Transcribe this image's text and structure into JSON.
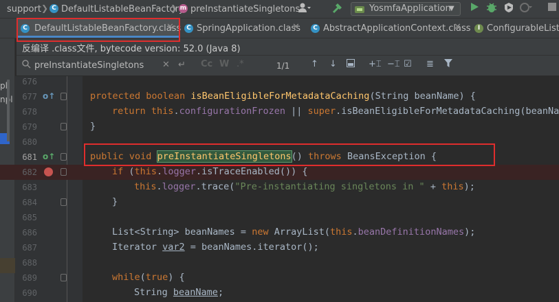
{
  "breadcrumb": {
    "items": [
      "support",
      "DefaultListableBeanFactory",
      "preInstantiateSingletons"
    ],
    "item_icons": [
      "",
      "class-icon",
      "method-icon"
    ]
  },
  "toolbar": {
    "run_config": "YosmfaApplication",
    "icons": [
      "user-icon",
      "build-hammer-icon",
      "run-icon",
      "debug-icon",
      "coverage-icon",
      "profile-icon",
      "stop-icon"
    ]
  },
  "tabs": [
    {
      "label": "DefaultListableBeanFactory.class",
      "active": true
    },
    {
      "label": "SpringApplication.class",
      "active": false
    },
    {
      "label": "AbstractApplicationContext.class",
      "active": false
    },
    {
      "label": "ConfigurableListab",
      "active": false
    }
  ],
  "banner": {
    "text": "反编译 .class文件, bytecode version: 52.0 (Java 8)"
  },
  "search": {
    "query": "preInstantiateSingletons",
    "match_count": "1/1",
    "case_label": "Cc",
    "word_label": "W",
    "regex_label": ".*"
  },
  "left_panel": {
    "labels": [
      "pl",
      "npl"
    ]
  },
  "code": {
    "lines": [
      {
        "num": "676",
        "text": ""
      },
      {
        "num": "677",
        "text": "protected boolean isBeanEligibleForMetadataCaching(String beanName) {"
      },
      {
        "num": "678",
        "text": "return this.configurationFrozen || super.isBeanEligibleForMetadataCaching(beanName"
      },
      {
        "num": "679",
        "text": "}"
      },
      {
        "num": "680",
        "text": ""
      },
      {
        "num": "681",
        "text": "public void preInstantiateSingletons() throws BeansException {"
      },
      {
        "num": "682",
        "text": "if (this.logger.isTraceEnabled()) {"
      },
      {
        "num": "683",
        "text": "this.logger.trace(\"Pre-instantiating singletons in \" + this);"
      },
      {
        "num": "684",
        "text": "}"
      },
      {
        "num": "685",
        "text": ""
      },
      {
        "num": "686",
        "text": "List<String> beanNames = new ArrayList(this.beanDefinitionNames);"
      },
      {
        "num": "687",
        "text": "Iterator var2 = beanNames.iterator();"
      },
      {
        "num": "688",
        "text": ""
      },
      {
        "num": "689",
        "text": "while(true) {"
      },
      {
        "num": "690",
        "text": "String beanName;"
      }
    ],
    "tokens": {
      "l677": [
        "protected",
        "boolean",
        "isBeanEligibleForMetadataCaching",
        "(String beanName) {"
      ],
      "l678": [
        "return",
        "this",
        ".",
        "configurationFrozen",
        " || ",
        "super",
        ".isBeanEligibleForMetadataCaching(beanName"
      ],
      "l681": [
        "public",
        "void",
        "preInstantiateSingletons",
        "() ",
        "throws",
        " BeansException {"
      ],
      "l682": [
        "if",
        " (",
        "this",
        ".",
        "logger",
        ".isTraceEnabled()) {"
      ],
      "l683": [
        "this",
        ".",
        "logger",
        ".trace(",
        "\"Pre-instantiating singletons in \"",
        " + ",
        "this",
        ");"
      ],
      "l686": [
        "List<String> beanNames = ",
        "new",
        " ArrayList(",
        "this",
        ".",
        "beanDefinitionNames",
        ");"
      ],
      "l687": [
        "Iterator ",
        "var2",
        " = beanNames.iterator();"
      ],
      "l689": [
        "while",
        "(",
        "true",
        ") {"
      ],
      "l690": [
        "String ",
        "beanName",
        ";"
      ]
    }
  },
  "colors": {
    "keyword": "#cc7832",
    "method": "#ffc66d",
    "field": "#9876aa",
    "string": "#6a8759",
    "annotation_box": "#e02d2d",
    "breakpoint": "#c75450"
  }
}
